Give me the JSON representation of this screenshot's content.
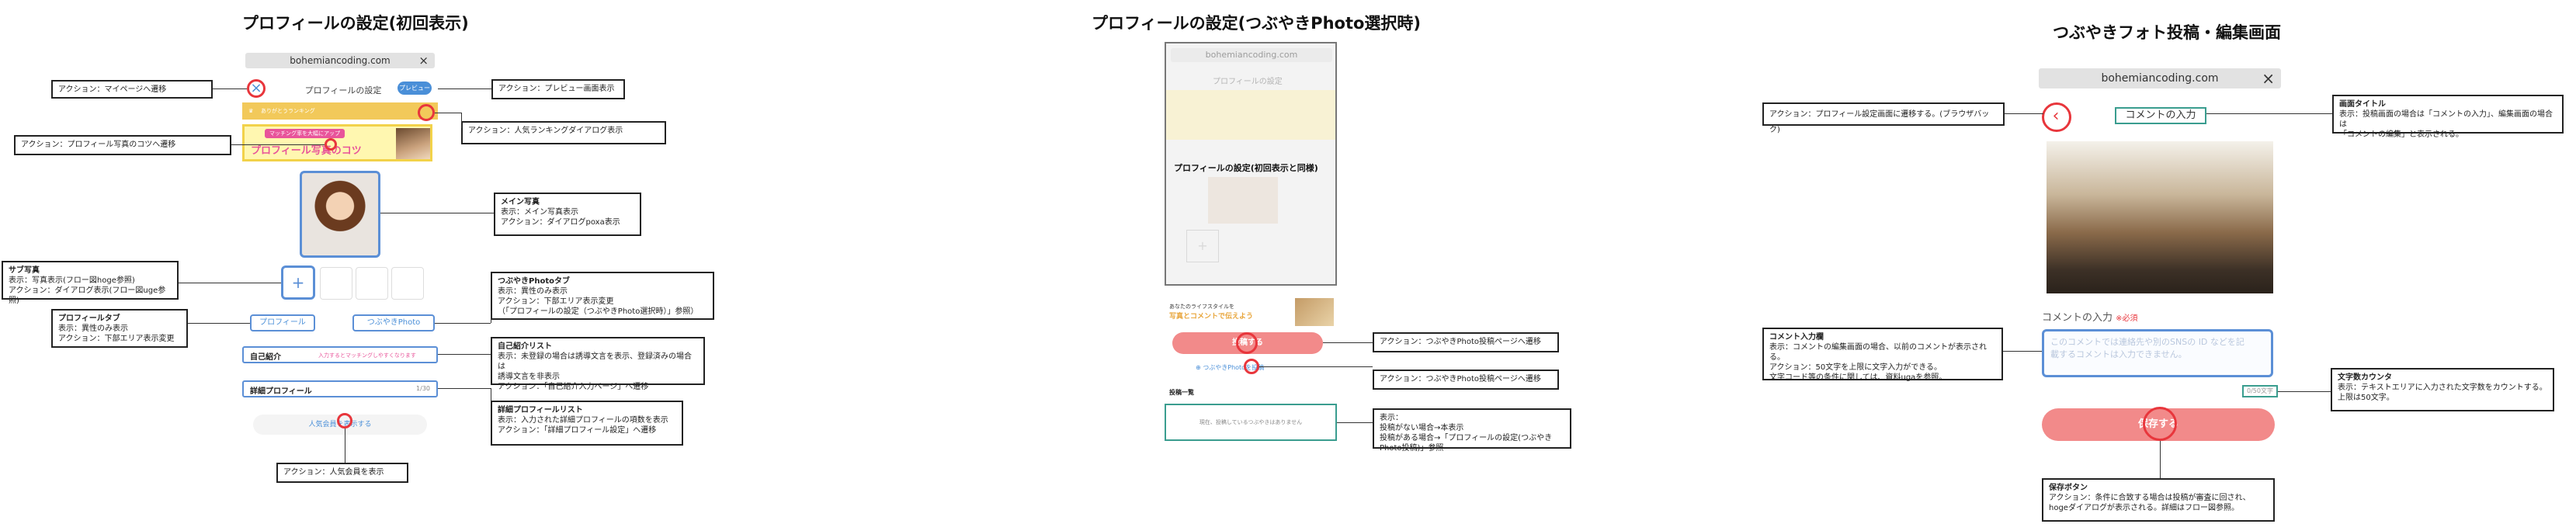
{
  "titles": {
    "s1": "プロフィールの設定(初回表示)",
    "s2": "プロフィールの設定(つぶやきPhoto選択時)",
    "s3": "つぶやきフォト投稿・編集画面"
  },
  "url": "bohemiancoding.com",
  "s1": {
    "header_title": "プロフィールの設定",
    "preview_label": "プレビュー",
    "ranking_bar": "ありがとうランキング",
    "banner_top": "マッチング率を大幅にアップ",
    "banner_main": "プロフィール写真のコツ",
    "add_symbol": "+",
    "tab_profile": "プロフィール",
    "tab_photo": "つぶやきPhoto",
    "intro_label": "自己紹介",
    "intro_hint": "入力するとマッチングしやすくなります",
    "detail_label": "詳細プロフィール",
    "detail_count": "1/30",
    "popular_button": "人気会員を表示する",
    "notes": {
      "mypage": "アクション：マイページへ遷移",
      "preview": "アクション：プレビュー画面表示",
      "ranking": "アクション：人気ランキングダイアログ表示",
      "tips": "アクション：プロフィール写真のコツへ遷移",
      "main_photo_h": "メイン写真",
      "main_photo_1": "表示：メイン写真表示",
      "main_photo_2": "アクション：ダイアログpoxa表示",
      "sub_photo_h": "サブ写真",
      "sub_photo_1": "表示：写真表示(フロー図hoge参照)",
      "sub_photo_2": "アクション：ダイアログ表示(フロー図uge参照)",
      "tab_photo_h": "つぶやきPhotoタブ",
      "tab_photo_1": "表示：異性のみ表示",
      "tab_photo_2": "アクション：下部エリア表示変更",
      "tab_photo_3": "（「プロフィールの設定（つぶやきPhoto選択時）」参照）",
      "tab_profile_h": "プロフィールタブ",
      "tab_profile_1": "表示：異性のみ表示",
      "tab_profile_2": "アクション：下部エリア表示変更",
      "intro_h": "自己紹介リスト",
      "intro_1": "表示：未登録の場合は誘導文言を表示、登録済みの場合は",
      "intro_2": "誘導文言を非表示",
      "intro_3": "アクション：「自己紹介入力ページ」へ遷移",
      "detail_h": "詳細プロフィールリスト",
      "detail_1": "表示：入力された詳細プロフィールの項数を表示",
      "detail_2": "アクション：「詳細プロフィール設定」へ遷移",
      "popular": "アクション：人気会員を表示"
    }
  },
  "s2": {
    "header_title": "プロフィールの設定",
    "overlay": "プロフィールの設定(初回表示と同様)",
    "lifestyle_1": "あなたのライフスタイルを",
    "lifestyle_2": "写真とコメントで伝えよう",
    "post_button": "投稿する",
    "post_link": "つぶやきPhotoを投稿",
    "list_label": "投稿一覧",
    "empty_text": "現在、投稿しているつぶやきはありません",
    "notes": {
      "post_button": "アクション：つぶやきPhoto投稿ページへ遷移",
      "post_link": "アクション：つぶやきPhoto投稿ページへ遷移",
      "empty_1": "表示：",
      "empty_2": "投稿がない場合→本表示",
      "empty_3": "投稿がある場合→「プロフィールの設定(つぶやきPhoto投稿)」参照"
    }
  },
  "s3": {
    "header_title": "コメントの入力",
    "comment_label": "コメントの入力",
    "required": "※必須",
    "placeholder_1": "このコメントでは連絡先や別のSNSの ID などを記",
    "placeholder_2": "載するコメントは入力できません。",
    "counter": "0/50文字",
    "save_button": "保存する",
    "notes": {
      "back": "アクション：プロフィール設定画面に遷移する。(ブラウザバック)",
      "title_h": "画面タイトル",
      "title_1": "表示：投稿画面の場合は「コメントの入力」、編集画面の場合は",
      "title_2": "「コメントの編集」と表示される。",
      "comment_h": "コメント入力欄",
      "comment_1": "表示：コメントの編集画面の場合、以前のコメントが表示される。",
      "comment_2": "アクション：50文字を上限に文字入力ができる。",
      "comment_3": "文字コード等の条件に関しては、資料ugaを参照。",
      "counter_h": "文字数カウンタ",
      "counter_1": "表示：テキストエリアに入力された文字数をカウントする。",
      "counter_2": "上限は50文字。",
      "save_h": "保存ボタン",
      "save_1": "アクション：条件に合致する場合は投稿が審査に回され、",
      "save_2": "hogeダイアログが表示される。詳細はフロー図参照。"
    }
  },
  "colors": {
    "accent_blue": "#4a8fd8",
    "annotation_red": "#e8363c",
    "banner_yellow": "#f2d24a",
    "banner_pink": "#e8549a",
    "save_pink": "#f28a8a",
    "teal": "#3a9d8f"
  }
}
